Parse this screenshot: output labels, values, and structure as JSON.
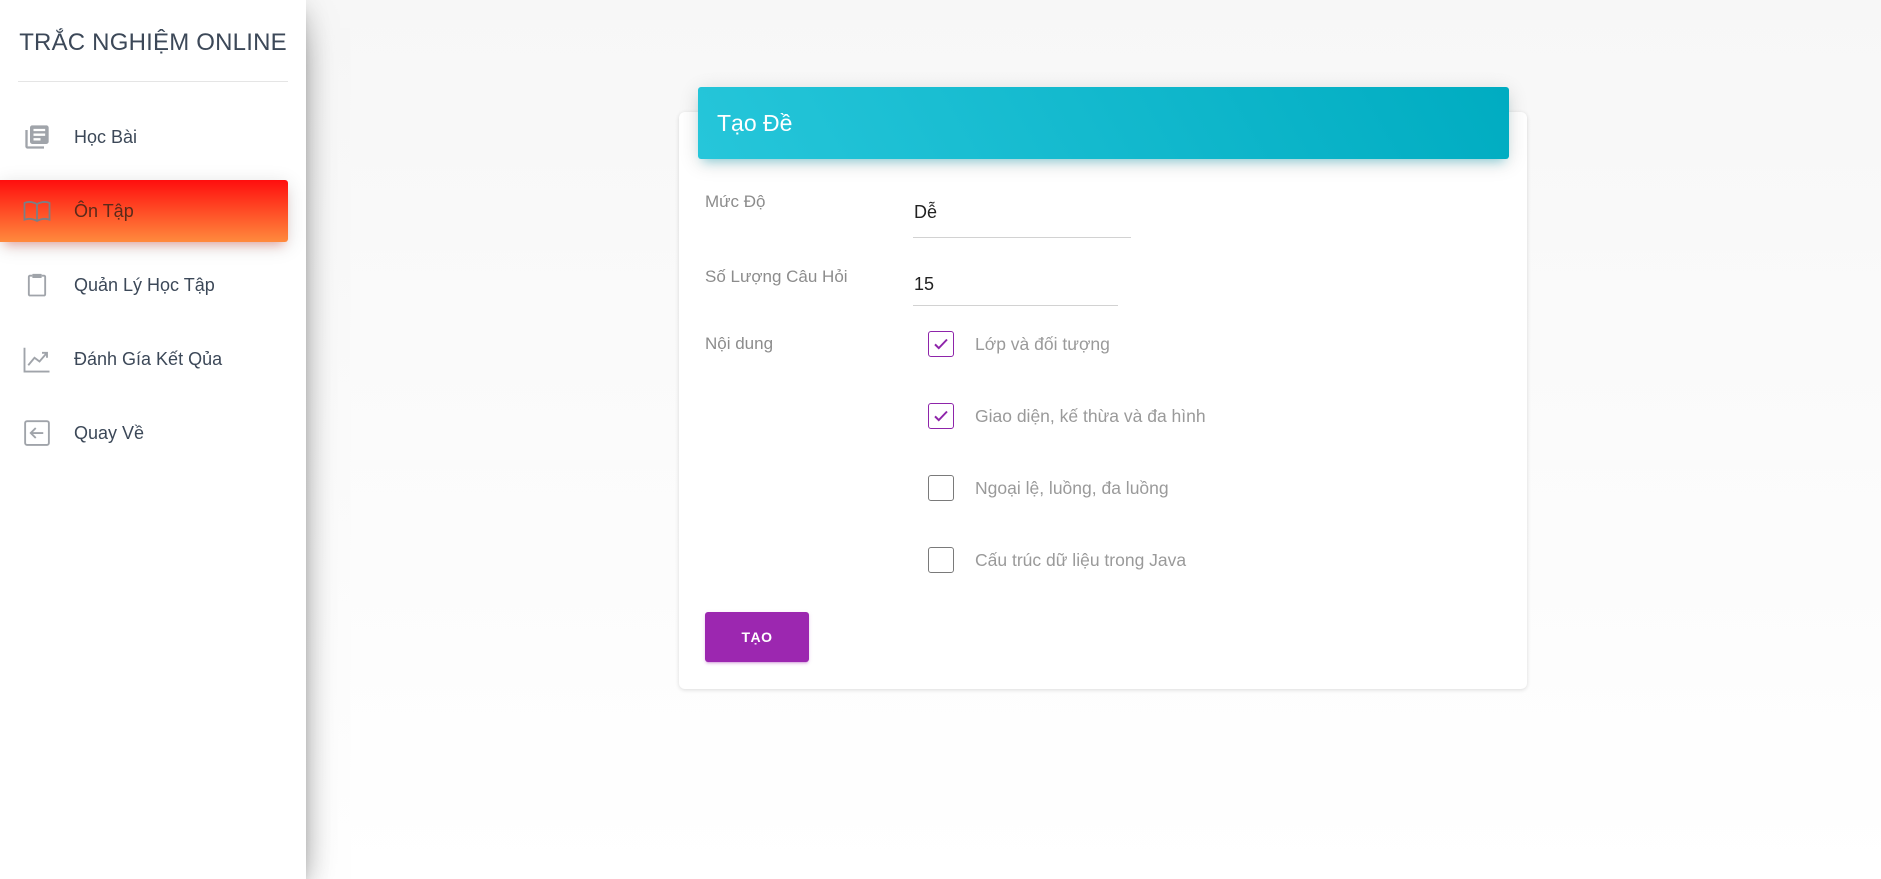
{
  "sidebar": {
    "brand": "TRẮC NGHIỆM ONLINE",
    "items": [
      {
        "label": "Học Bài",
        "icon": "library-books-icon"
      },
      {
        "label": "Ôn Tập",
        "icon": "book-open-icon",
        "active": true
      },
      {
        "label": "Quản Lý Học Tập",
        "icon": "clipboard-icon"
      },
      {
        "label": "Đánh Gía Kết Qủa",
        "icon": "trending-up-icon"
      },
      {
        "label": "Quay Về",
        "icon": "back-arrow-icon"
      }
    ]
  },
  "form": {
    "title": "Tạo Đề",
    "level_label": "Mức Độ",
    "level_value": "Dễ",
    "count_label": "Số Lượng Câu Hỏi",
    "count_value": "15",
    "content_label": "Nội dung",
    "topics": [
      {
        "label": "Lớp và đối tượng",
        "checked": true
      },
      {
        "label": "Giao diện, kế thừa và đa hình",
        "checked": true
      },
      {
        "label": "Ngoại lệ, luồng, đa luồng",
        "checked": false
      },
      {
        "label": "Cấu trúc dữ liệu trong Java",
        "checked": false
      }
    ],
    "submit_label": "TẠO"
  },
  "colors": {
    "header_gradient_start": "#26c6da",
    "header_gradient_end": "#00acc1",
    "active_gradient_start": "#ff0e0e",
    "active_gradient_end": "#ff8a3d",
    "button": "#9c27b0"
  }
}
